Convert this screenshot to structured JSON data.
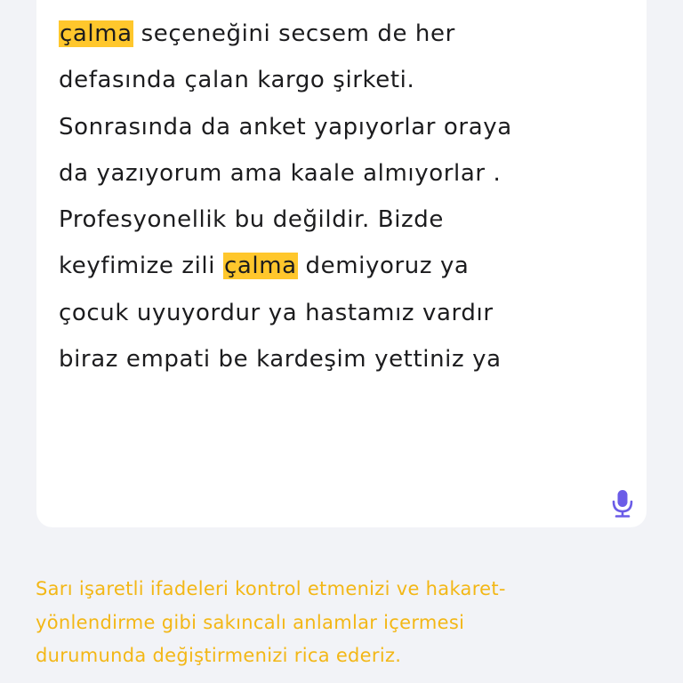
{
  "editor": {
    "lines": [
      {
        "highlight": "çalma",
        "text": " seçeneğini secsem de her"
      },
      "defasında çalan kargo şirketi.",
      "Sonrasında da anket yapıyorlar oraya",
      "da yazıyorum ama kaale almıyorlar .",
      "Profesyonellik bu değildir. Bizde",
      {
        "before": "keyfimize zili ",
        "highlight": "çalma",
        "after": " demiyoruz ya"
      },
      "çocuk uyuyordur ya hastamız vardır",
      "biraz empati be kardeşim yettiniz ya"
    ],
    "mic_icon": "microphone-icon"
  },
  "warning": {
    "lines": [
      "Sarı işaretli ifadeleri kontrol etmenizi ve hakaret-",
      "yönlendirme gibi sakıncalı anlamlar içermesi",
      "durumunda değiştirmenizi rica ederiz."
    ]
  },
  "colors": {
    "highlight": "#ffc72c",
    "warning_text": "#f3b716",
    "mic": "#6b5ce7",
    "background": "#f2f3f7"
  }
}
